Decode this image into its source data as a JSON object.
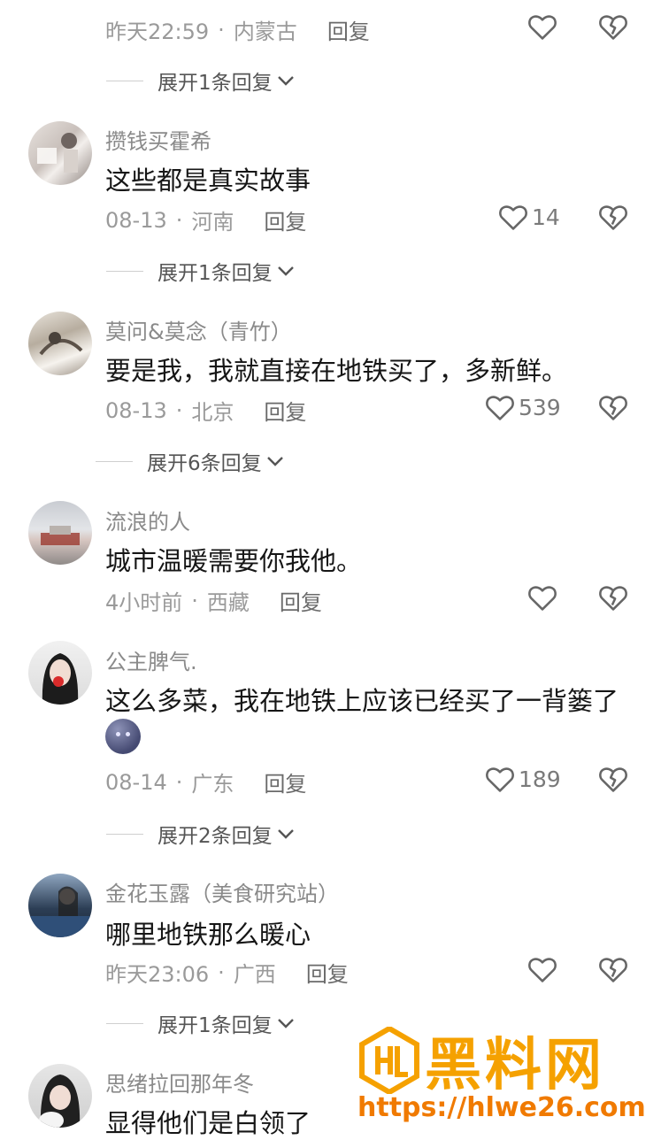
{
  "comments": [
    {
      "user": "",
      "text": "",
      "time": "昨天22:59",
      "region": "内蒙古",
      "reply": "回复",
      "likes": "",
      "expand": "展开1条回复"
    },
    {
      "user": "攒钱买霍希",
      "text": "这些都是真实故事",
      "time": "08-13",
      "region": "河南",
      "reply": "回复",
      "likes": "14",
      "expand": "展开1条回复"
    },
    {
      "user": "莫问&莫念（青竹）",
      "text": "要是我，我就直接在地铁买了，多新鲜。",
      "time": "08-13",
      "region": "北京",
      "reply": "回复",
      "likes": "539",
      "expand": "展开6条回复"
    },
    {
      "user": "流浪的人",
      "text": "城市温暖需要你我他。",
      "time": "4小时前",
      "region": "西藏",
      "reply": "回复",
      "likes": ""
    },
    {
      "user": "公主脾气.",
      "text": "这么多菜，我在地铁上应该已经买了一背篓了",
      "time": "08-14",
      "region": "广东",
      "reply": "回复",
      "likes": "189",
      "expand": "展开2条回复"
    },
    {
      "user": "金花玉露（美食研究站）",
      "text": "哪里地铁那么暖心",
      "time": "昨天23:06",
      "region": "广西",
      "reply": "回复",
      "likes": "",
      "expand": "展开1条回复"
    },
    {
      "user": "思绪拉回那年冬",
      "text": "显得他们是白领了"
    }
  ],
  "meta_separator": "·",
  "icons": {
    "like": "heart-outline-icon",
    "dislike": "broken-heart-icon",
    "expand": "chevron-down-icon",
    "emoji": "dark-moon-emoji-icon"
  },
  "watermark": {
    "title": "黑料网",
    "url": "https://hlwe26.com"
  },
  "colors": {
    "text": "#161616",
    "secondary": "#9a9a9a",
    "watermark": "#f5a100"
  }
}
